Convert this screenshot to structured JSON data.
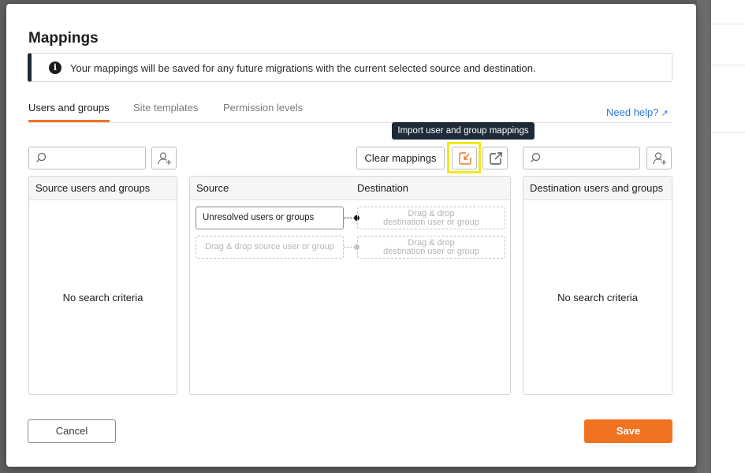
{
  "dialog": {
    "title": "Mappings",
    "info_text": "Your mappings will be saved for any future migrations with the current selected source and destination."
  },
  "tabs": [
    {
      "label": "Users and groups",
      "active": true
    },
    {
      "label": "Site templates",
      "active": false
    },
    {
      "label": "Permission levels",
      "active": false
    }
  ],
  "help_link": "Need help?",
  "toolbar": {
    "clear_label": "Clear mappings",
    "tooltip": "Import user and group mappings",
    "source_search_placeholder": "",
    "dest_search_placeholder": ""
  },
  "source_panel": {
    "header": "Source users and groups",
    "empty": "No search criteria"
  },
  "mapping_panel": {
    "source_header": "Source",
    "dest_header": "Destination",
    "rows": [
      {
        "source": "Unresolved users or groups",
        "dest_line1": "Drag & drop",
        "dest_line2": "destination user or group"
      },
      {
        "source": "Drag & drop source user or group",
        "dest_line1": "Drag & drop",
        "dest_line2": "destination user or group"
      }
    ]
  },
  "dest_panel": {
    "header": "Destination users and groups",
    "empty": "No search criteria"
  },
  "footer": {
    "cancel_label": "Cancel",
    "save_label": "Save"
  },
  "colors": {
    "accent": "#f07322",
    "link": "#2b7bd6",
    "highlight": "#f2ea1b",
    "tooltip_bg": "#1f2a38"
  }
}
